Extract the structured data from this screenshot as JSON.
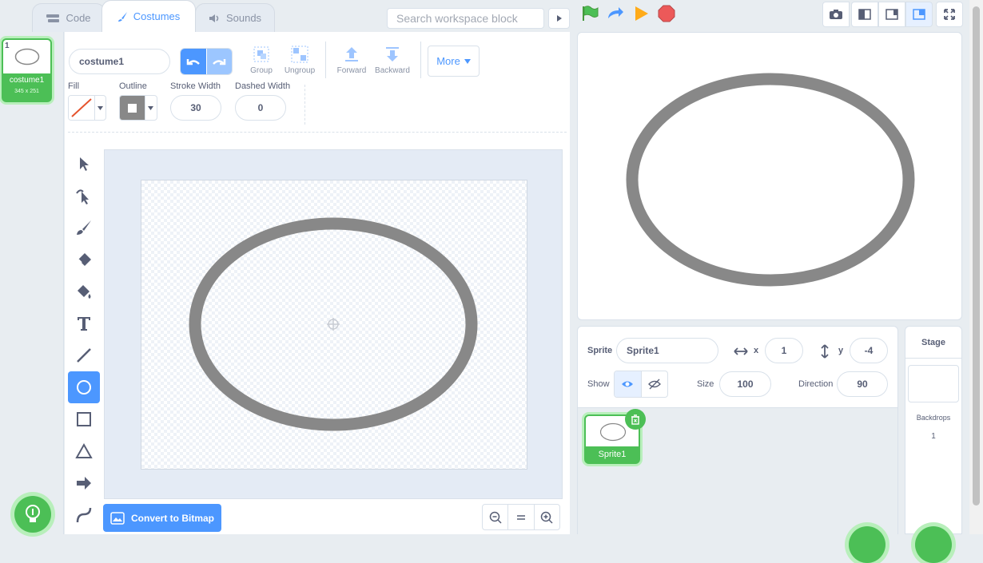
{
  "tabs": [
    {
      "label": "Code"
    },
    {
      "label": "Costumes"
    },
    {
      "label": "Sounds"
    }
  ],
  "search": {
    "placeholder": "Search workspace block"
  },
  "costume_list": [
    {
      "index": "1",
      "name": "costume1",
      "size": "345 x 251"
    }
  ],
  "editor": {
    "costume_name": "costume1",
    "group_label": "Group",
    "ungroup_label": "Ungroup",
    "forward_label": "Forward",
    "backward_label": "Backward",
    "more_label": "More",
    "fill_label": "Fill",
    "outline_label": "Outline",
    "stroke_width_label": "Stroke Width",
    "stroke_width_value": "30",
    "dashed_width_label": "Dashed Width",
    "dashed_width_value": "0",
    "convert_label": "Convert to Bitmap",
    "outline_color": "#888888",
    "accent": "#4c97ff",
    "tools": [
      "select-icon",
      "reshape-icon",
      "brush-icon",
      "eraser-icon",
      "fill-icon",
      "text-icon",
      "line-icon",
      "circle-icon",
      "rectangle-icon",
      "triangle-icon",
      "arrow-icon",
      "curve-icon"
    ],
    "active_tool": "circle-icon"
  },
  "sprite_info": {
    "sprite_label": "Sprite",
    "sprite_name": "Sprite1",
    "x_label": "x",
    "x_value": "1",
    "y_label": "y",
    "y_value": "-4",
    "show_label": "Show",
    "size_label": "Size",
    "size_value": "100",
    "direction_label": "Direction",
    "direction_value": "90"
  },
  "sprites": [
    {
      "name": "Sprite1"
    }
  ],
  "stage_panel": {
    "title": "Stage",
    "backdrops_label": "Backdrops",
    "backdrops_count": "1"
  }
}
